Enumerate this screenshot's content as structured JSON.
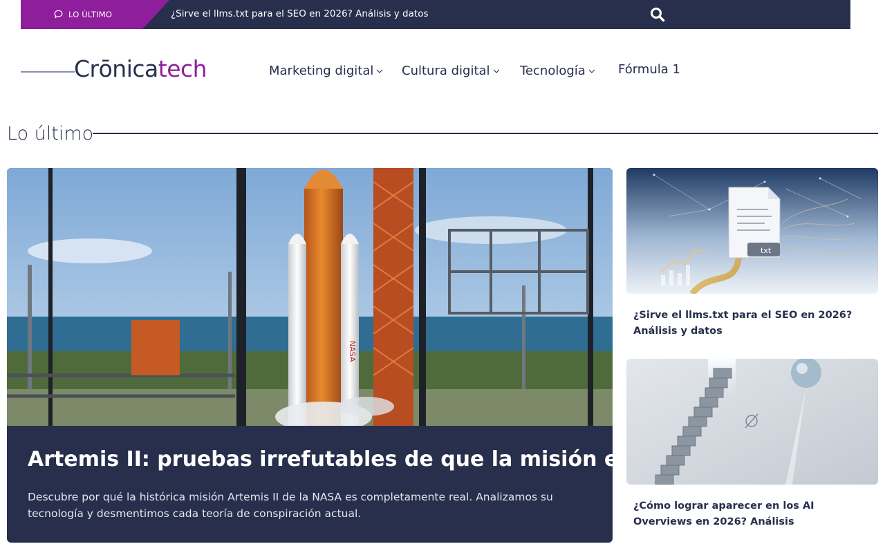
{
  "ticker": {
    "label": "LO ÚLTIMO",
    "headline": "¿Sirve el llms.txt para el SEO en 2026? Análisis y datos"
  },
  "logo": {
    "part1": "Crōnica",
    "part2": "tech"
  },
  "nav": {
    "items": [
      {
        "label": "Marketing digital"
      },
      {
        "label": "Cultura digital"
      },
      {
        "label": "Tecnología"
      },
      {
        "label": "Fórmula 1"
      }
    ]
  },
  "section": {
    "title": "Lo último"
  },
  "featured": {
    "title": "Artemis II: pruebas irrefutables de que la misión es real",
    "description": "Descubre por qué la histórica misión Artemis II de la NASA es completamente real. Analizamos su tecnología y desmentimos cada teoría de conspiración actual.",
    "image_text": "NASA"
  },
  "side_articles": [
    {
      "title": "¿Sirve el llms.txt para el SEO en 2026? Análisis y datos",
      "image_text": "txt"
    },
    {
      "title": "¿Cómo lograr aparecer en los AI Overviews en 2026? Análisis"
    }
  ],
  "colors": {
    "navy": "#272f4c",
    "purple": "#8e1e9b"
  },
  "icons": {
    "ticker": "chat-bubble-icon",
    "search": "search-icon",
    "dropdown": "chevron-down-icon"
  }
}
